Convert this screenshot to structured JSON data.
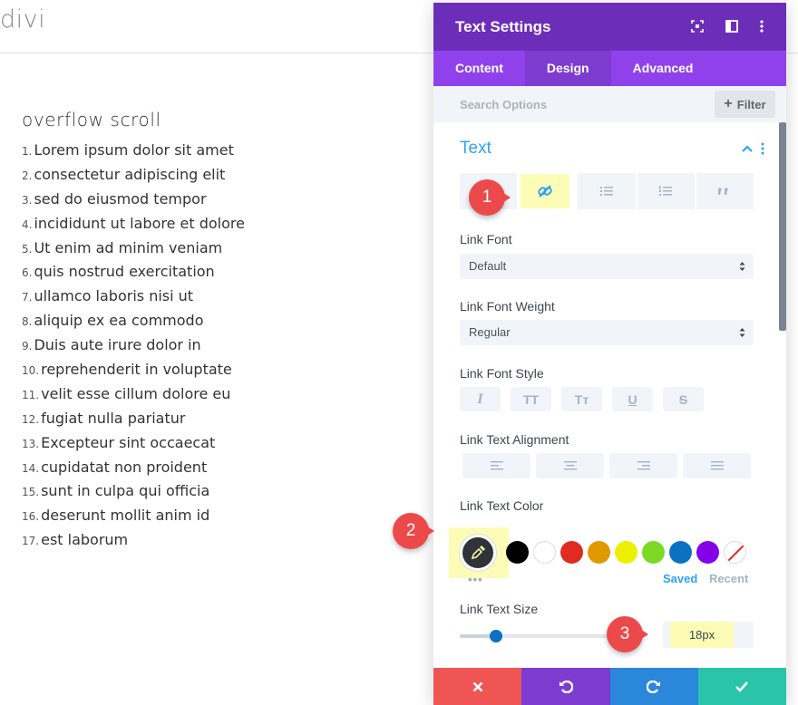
{
  "page": {
    "logo": "divi",
    "list_title": "overflow scroll",
    "list_items": [
      {
        "num": "1.",
        "text": "Lorem ipsum dolor sit amet"
      },
      {
        "num": "2.",
        "text": "consectetur adipiscing elit"
      },
      {
        "num": "3.",
        "text": "sed do eiusmod tempor"
      },
      {
        "num": "4.",
        "text": "incididunt ut labore et dolore"
      },
      {
        "num": "5.",
        "text": "Ut enim ad minim veniam"
      },
      {
        "num": "6.",
        "text": "quis nostrud exercitation"
      },
      {
        "num": "7.",
        "text": "ullamco laboris nisi ut"
      },
      {
        "num": "8.",
        "text": "aliquip ex ea commodo"
      },
      {
        "num": "9.",
        "text": "Duis aute irure dolor in"
      },
      {
        "num": "10.",
        "text": "reprehenderit in voluptate"
      },
      {
        "num": "11.",
        "text": "velit esse cillum dolore eu"
      },
      {
        "num": "12.",
        "text": "fugiat nulla pariatur"
      },
      {
        "num": "13.",
        "text": "Excepteur sint occaecat"
      },
      {
        "num": "14.",
        "text": "cupidatat non proident"
      },
      {
        "num": "15.",
        "text": "sunt in culpa qui officia"
      },
      {
        "num": "16.",
        "text": "deserunt mollit anim id"
      },
      {
        "num": "17.",
        "text": "est laborum"
      }
    ]
  },
  "modal": {
    "title": "Text Settings",
    "header_icons": [
      "expand-icon",
      "sidebar-icon",
      "more-vertical-icon"
    ],
    "tabs": [
      {
        "label": "Content",
        "active": false
      },
      {
        "label": "Design",
        "active": true
      },
      {
        "label": "Advanced",
        "active": false
      }
    ],
    "search_placeholder": "Search Options",
    "filter_label": "Filter",
    "section_title": "Text",
    "subtabs": [
      "text-icon",
      "link-icon",
      "unordered-list-icon",
      "ordered-list-icon",
      "quote-icon"
    ],
    "link_font": {
      "label": "Link Font",
      "value": "Default"
    },
    "link_font_weight": {
      "label": "Link Font Weight",
      "value": "Regular"
    },
    "link_font_style": {
      "label": "Link Font Style",
      "buttons": [
        "I",
        "TT",
        "Tт",
        "U",
        "S"
      ]
    },
    "link_text_alignment": {
      "label": "Link Text Alignment"
    },
    "link_text_color": {
      "label": "Link Text Color",
      "swatches": [
        "#000000",
        "#ffffff",
        "#e02b20",
        "#e09900",
        "#edf000",
        "#7cda24",
        "#0c71c3",
        "#8300e9"
      ],
      "more": "•••",
      "saved": "Saved",
      "recent": "Recent"
    },
    "link_text_size": {
      "label": "Link Text Size",
      "value": "18px",
      "slider_fraction": 0.2
    },
    "footer_colors": {
      "cancel": "#ef5555",
      "undo": "#7e3bd0",
      "redo": "#2b87da",
      "save": "#29c4a9"
    }
  },
  "callouts": [
    "1",
    "2",
    "3"
  ],
  "colors": {
    "header": "#6c2eb9",
    "tabs": "#8f42ec",
    "accent": "#2ea3f2",
    "highlight": "#fcfcb6",
    "callout": "#ec4a4a"
  }
}
